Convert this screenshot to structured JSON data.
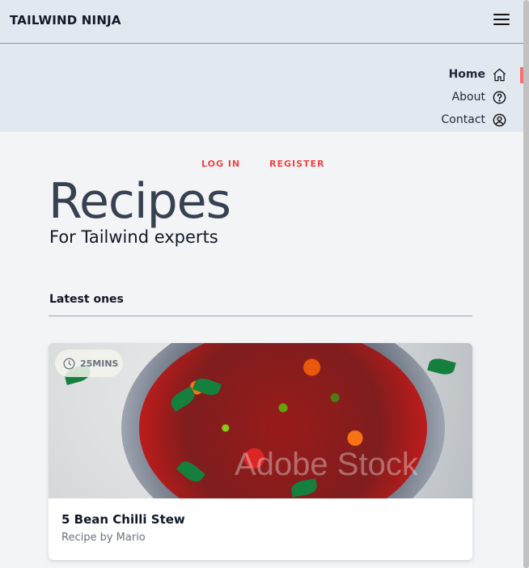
{
  "header": {
    "brand": "TAILWIND NINJA",
    "menu_icon": "hamburger-menu-icon"
  },
  "nav": {
    "items": [
      {
        "label": "Home",
        "icon": "home-icon",
        "active": true
      },
      {
        "label": "About",
        "icon": "question-circle-icon",
        "active": false
      },
      {
        "label": "Contact",
        "icon": "user-circle-icon",
        "active": false
      }
    ],
    "active_indicator_color": "#f87171"
  },
  "auth": {
    "login_label": "LOG IN",
    "register_label": "REGISTER"
  },
  "hero": {
    "title": "Recipes",
    "subtitle": "For Tailwind experts"
  },
  "section": {
    "title": "Latest ones"
  },
  "recipe_card": {
    "time_badge": "25MINS",
    "time_icon": "clock-icon",
    "image_watermark": "Adobe Stock",
    "title": "5 Bean Chilli Stew",
    "author_line": "Recipe by Mario"
  },
  "colors": {
    "accent": "#ef4444",
    "header_bg": "#e2e8f0",
    "page_bg": "#f3f4f6"
  }
}
